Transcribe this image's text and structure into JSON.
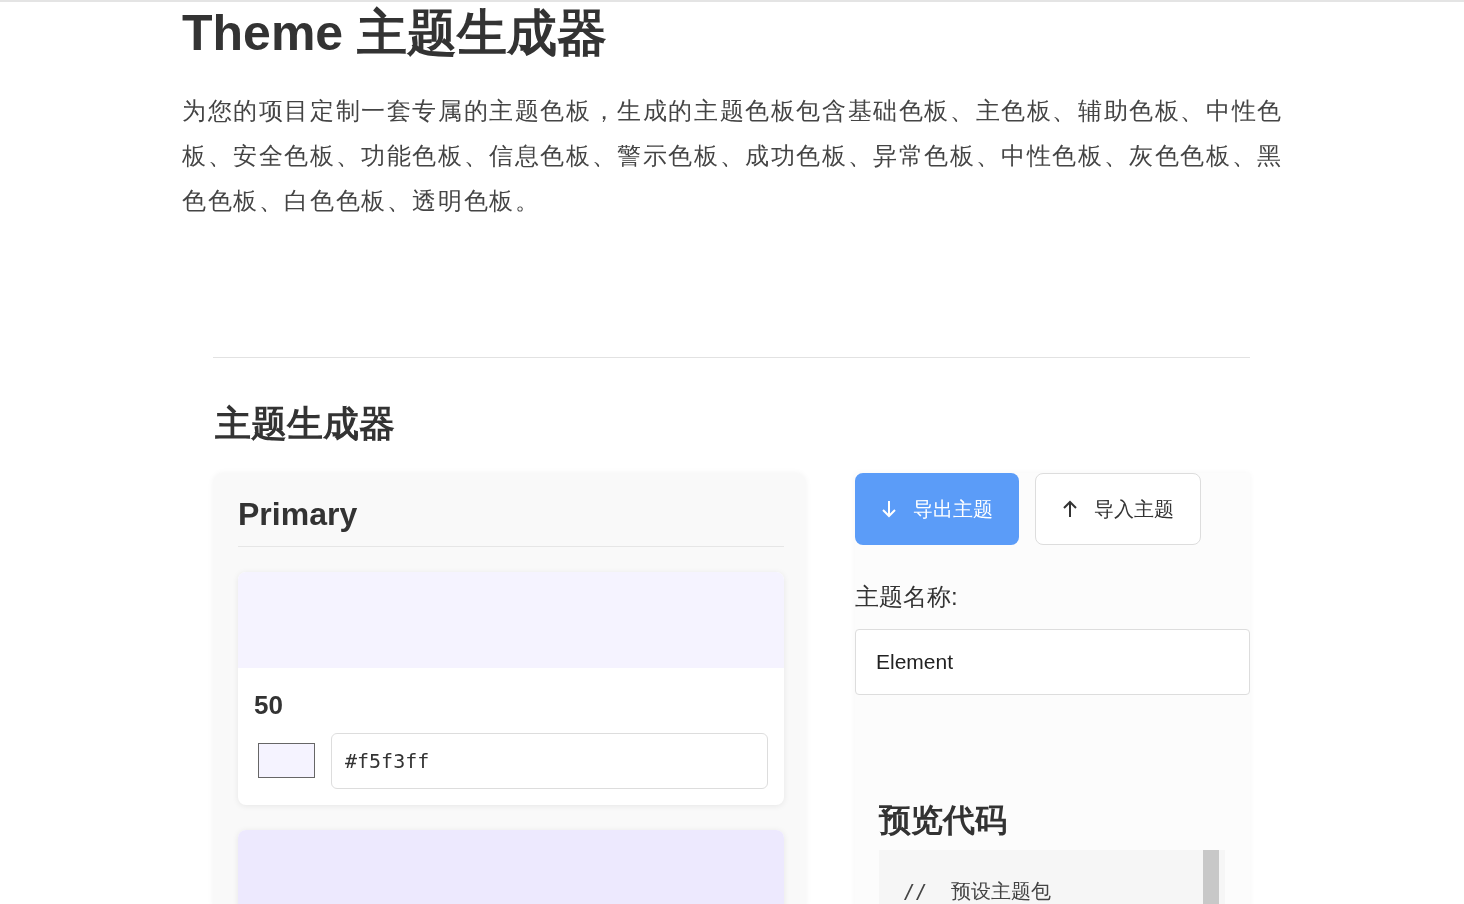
{
  "page": {
    "title": "Theme 主题生成器",
    "description": "为您的项目定制一套专属的主题色板，生成的主题色板包含基础色板、主色板、辅助色板、中性色板、安全色板、功能色板、信息色板、警示色板、成功色板、异常色板、中性色板、灰色色板、黑色色板、白色色板、透明色板。"
  },
  "generator": {
    "heading": "主题生成器",
    "palette": {
      "title": "Primary",
      "swatches": [
        {
          "label": "50",
          "color": "#f5f3ff",
          "value": "#f5f3ff"
        },
        {
          "color": "#ede9fe"
        }
      ]
    },
    "actions": [
      {
        "kind": "export",
        "label": "导出主题",
        "primary": true
      },
      {
        "kind": "import",
        "label": "导入主题",
        "primary": false
      }
    ],
    "name_label": "主题名称:",
    "name_value": "Element",
    "preview": {
      "heading": "预览代码",
      "code": "//  预设主题包"
    }
  }
}
